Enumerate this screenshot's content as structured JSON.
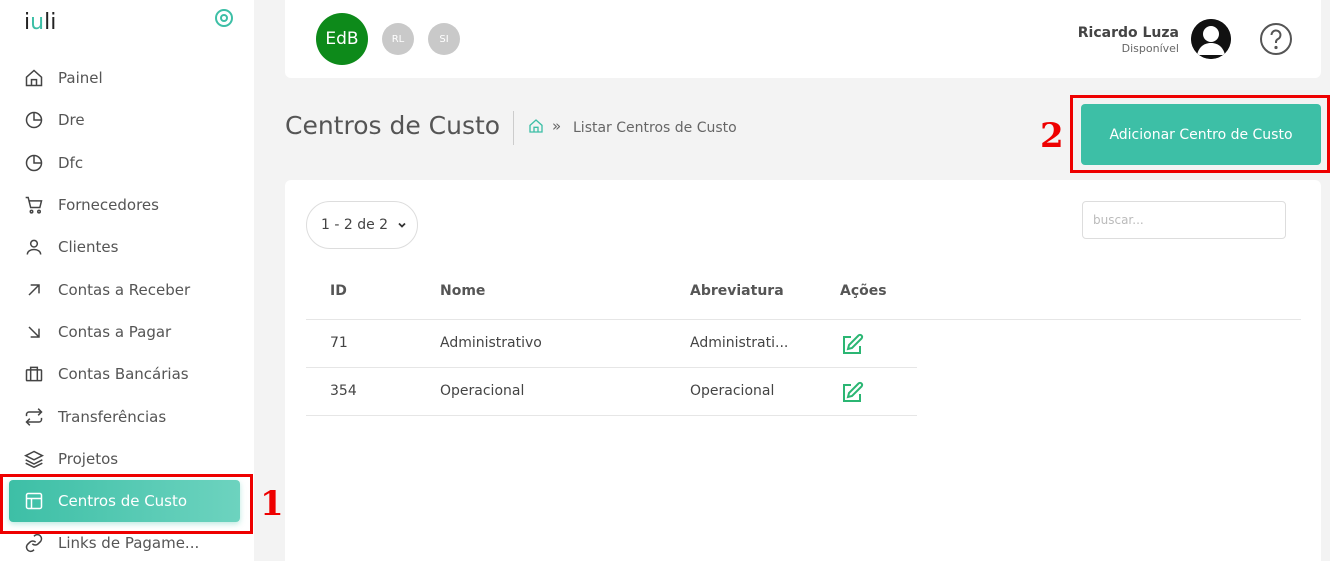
{
  "brand": {
    "logo_text_pre": "i",
    "logo_text_u": "u",
    "logo_text_post": "li"
  },
  "colors": {
    "accent": "#3dbfa6",
    "org_badge": "#0d8a1a",
    "annotation": "#e00000"
  },
  "sidebar": {
    "items": [
      {
        "label": "Painel",
        "icon": "home-icon"
      },
      {
        "label": "Dre",
        "icon": "pie-chart-icon"
      },
      {
        "label": "Dfc",
        "icon": "pie-chart-icon"
      },
      {
        "label": "Fornecedores",
        "icon": "cart-icon"
      },
      {
        "label": "Clientes",
        "icon": "user-icon"
      },
      {
        "label": "Contas a Receber",
        "icon": "arrow-up-right-icon"
      },
      {
        "label": "Contas a Pagar",
        "icon": "arrow-down-right-icon"
      },
      {
        "label": "Contas Bancárias",
        "icon": "briefcase-icon"
      },
      {
        "label": "Transferências",
        "icon": "repeat-icon"
      },
      {
        "label": "Projetos",
        "icon": "layers-icon"
      },
      {
        "label": "Centros de Custo",
        "icon": "layout-icon",
        "active": true
      },
      {
        "label": "Links de Pagame...",
        "icon": "link-icon"
      }
    ]
  },
  "header": {
    "org_active": "EdB",
    "org_others": [
      "RL",
      "SI"
    ],
    "user_name": "Ricardo Luza",
    "user_status": "Disponível"
  },
  "page": {
    "title": "Centros de Custo",
    "breadcrumb_sep": "»",
    "breadcrumb": "Listar Centros de Custo",
    "add_button": "Adicionar Centro de Custo"
  },
  "annotations": {
    "one": "1",
    "two": "2"
  },
  "table": {
    "pager": "1 - 2 de 2",
    "search_placeholder": "buscar...",
    "headers": {
      "id": "ID",
      "nome": "Nome",
      "abreviatura": "Abreviatura",
      "acoes": "Ações"
    },
    "rows": [
      {
        "id": "71",
        "nome": "Administrativo",
        "abreviatura": "Administrati..."
      },
      {
        "id": "354",
        "nome": "Operacional",
        "abreviatura": "Operacional"
      }
    ]
  }
}
